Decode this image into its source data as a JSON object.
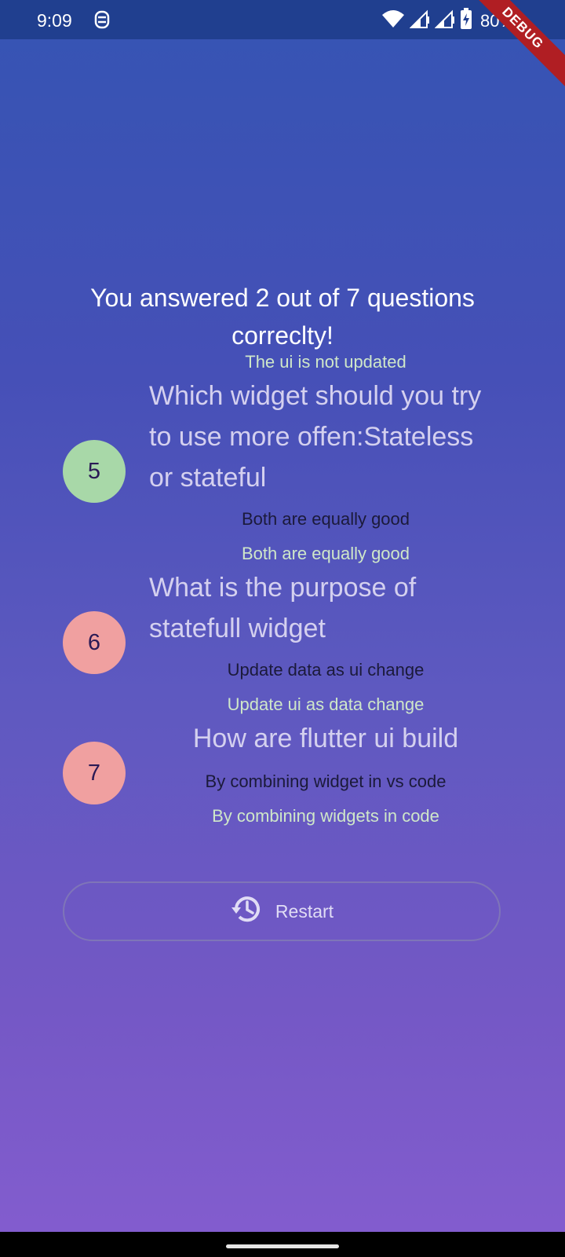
{
  "status_bar": {
    "time": "9:09",
    "battery": "80%",
    "icons": [
      "notification-icon",
      "wifi-icon",
      "signal-icon",
      "signal-icon-2",
      "battery-icon"
    ]
  },
  "debug_banner": "DEBUG",
  "result": {
    "title": "You answered 2 out of 7 questions correclty!"
  },
  "summary": [
    {
      "number": "5",
      "correct_before": "The ui is not updated",
      "question": "Which widget should you try to use more offen:Stateless or stateful",
      "user_answer": "Both are equally good",
      "correct_answer": "Both are equally good",
      "color": "#a8d8a8"
    },
    {
      "number": "6",
      "question": "What is the purpose of statefull widget",
      "user_answer": "Update data as ui change",
      "correct_answer": "Update ui as data change",
      "color": "#f0a0a0"
    },
    {
      "number": "7",
      "question": "How are flutter ui build",
      "user_answer": "By combining widget in vs code",
      "correct_answer": "By combining widgets in code",
      "color": "#f0a0a0"
    }
  ],
  "restart_label": "Restart"
}
